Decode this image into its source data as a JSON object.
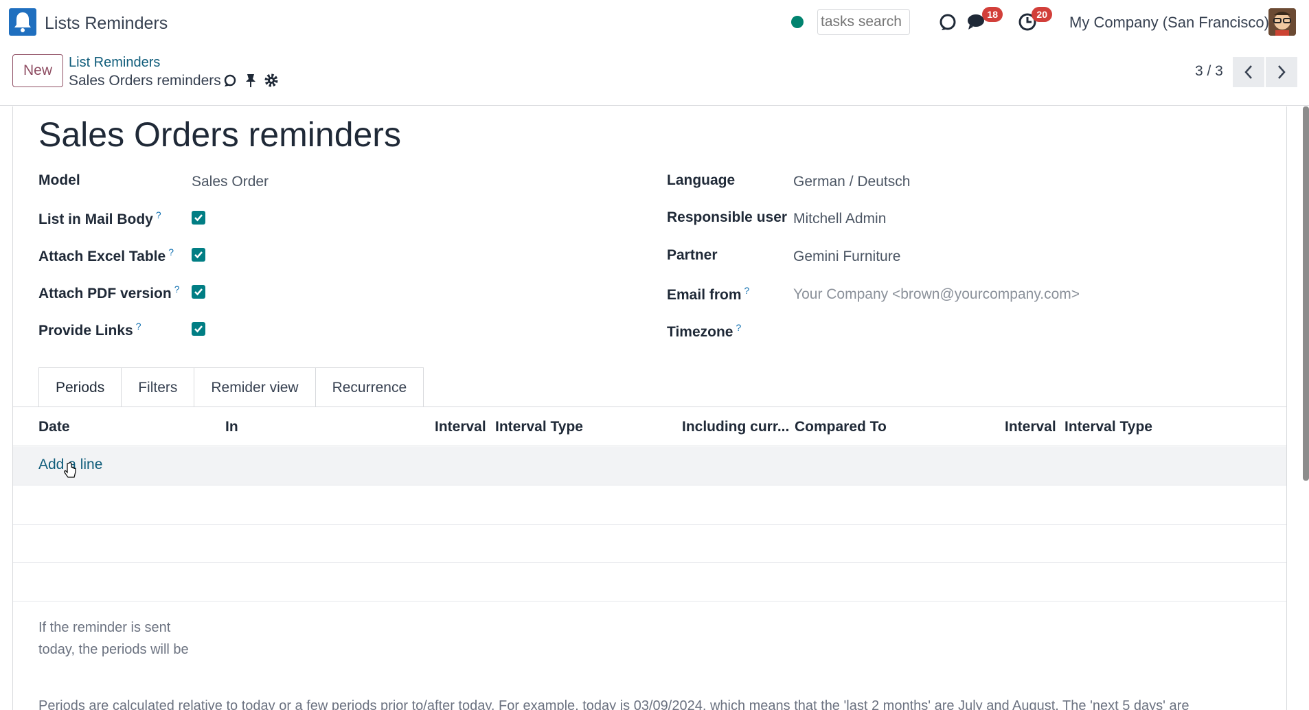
{
  "navbar": {
    "app_title": "Lists Reminders",
    "search_placeholder": "tasks search",
    "messages_count": "18",
    "activities_count": "20",
    "company": "My Company (San Francisco)"
  },
  "control_panel": {
    "new_label": "New",
    "breadcrumb_parent": "List Reminders",
    "breadcrumb_current": "Sales Orders reminders",
    "pager": "3 / 3"
  },
  "form": {
    "title": "Sales Orders reminders",
    "left_fields": [
      {
        "label": "Model",
        "value": "Sales Order",
        "help": false
      },
      {
        "label": "List in Mail Body",
        "checked": true,
        "help": true
      },
      {
        "label": "Attach Excel Table",
        "checked": true,
        "help": true
      },
      {
        "label": "Attach PDF version",
        "checked": true,
        "help": true
      },
      {
        "label": "Provide Links",
        "checked": true,
        "help": true
      }
    ],
    "right_fields": [
      {
        "label": "Language",
        "value": "German / Deutsch",
        "help": false
      },
      {
        "label": "Responsible user",
        "value": "Mitchell Admin",
        "help": false
      },
      {
        "label": "Partner",
        "value": "Gemini Furniture",
        "help": false
      },
      {
        "label": "Email from",
        "value": "Your Company <brown@yourcompany.com>",
        "help": true
      },
      {
        "label": "Timezone",
        "value": "",
        "help": true
      }
    ],
    "help_mark": "?"
  },
  "tabs": [
    "Periods",
    "Filters",
    "Remider view",
    "Recurrence"
  ],
  "table": {
    "columns": [
      "Date",
      "In",
      "Interval",
      "Interval Type",
      "Including curr...",
      "Compared To",
      "Interval",
      "Interval Type"
    ],
    "add_line": "Add a line"
  },
  "help_text": {
    "short": "If the reminder is sent today, the periods will be",
    "long": "Periods are calculated relative to today or a few periods prior to/after today. For example, today is 03/09/2024, which means that the 'last 2 months' are July and August. The 'next 5 days' are"
  },
  "colors": {
    "accent": "#017e84",
    "brand": "#8f4e63",
    "link": "#0f5c7a",
    "badge": "#d23f3a",
    "online": "#01836f"
  }
}
